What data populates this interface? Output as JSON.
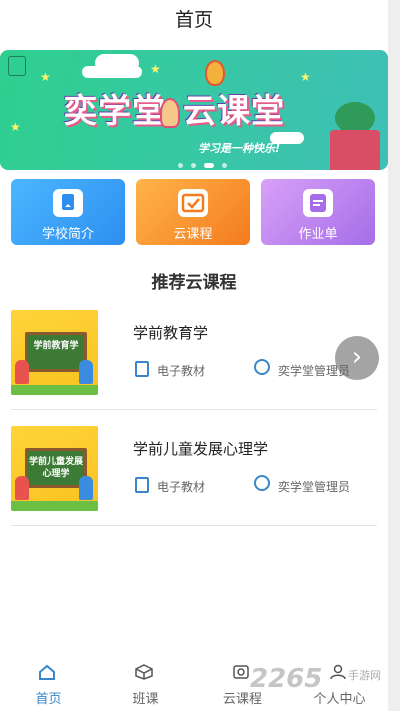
{
  "header": {
    "title": "首页"
  },
  "banner": {
    "title_part1": "奕学堂",
    "title_part2": "云课堂",
    "slogan": "学习是一种快乐!"
  },
  "tiles": [
    {
      "label": "学校简介",
      "icon": "book-icon"
    },
    {
      "label": "云课程",
      "icon": "checkbox-icon"
    },
    {
      "label": "作业单",
      "icon": "note-icon"
    }
  ],
  "section": {
    "title": "推荐云课程"
  },
  "courses": [
    {
      "name": "学前教育学",
      "thumb_text": "学前教育学",
      "type": "电子教材",
      "author": "奕学堂管理员"
    },
    {
      "name": "学前儿童发展心理学",
      "thumb_text": "学前儿童发展心理学",
      "type": "电子教材",
      "author": "奕学堂管理员"
    }
  ],
  "tabbar": [
    {
      "label": "首页",
      "icon": "home-icon",
      "active": true
    },
    {
      "label": "班课",
      "icon": "box-icon",
      "active": false
    },
    {
      "label": "云课程",
      "icon": "cloud-course-icon",
      "active": false
    },
    {
      "label": "个人中心",
      "icon": "user-icon",
      "active": false
    }
  ],
  "watermark": {
    "text": "2265",
    "sub": "手游网"
  },
  "colors": {
    "accent": "#3a86c8",
    "banner": "#36c9a2"
  }
}
